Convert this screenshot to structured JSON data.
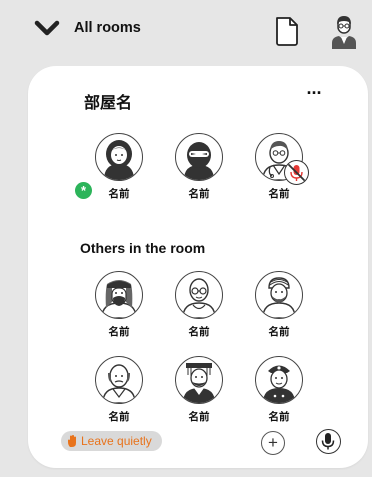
{
  "header": {
    "rooms_label": "All rooms",
    "icons": [
      "chevron-down-icon",
      "document-icon",
      "user-avatar-icon"
    ]
  },
  "room": {
    "name": "部屋名",
    "more_label": "···",
    "speakers": [
      {
        "name": "名前",
        "avatar": "hijab-woman-icon",
        "status": "active"
      },
      {
        "name": "名前",
        "avatar": "ninja-icon"
      },
      {
        "name": "名前",
        "avatar": "doctor-icon",
        "mic": "muted"
      }
    ],
    "others_title": "Others in the room",
    "others": [
      {
        "name": "名前",
        "avatar": "arab-man-icon"
      },
      {
        "name": "名前",
        "avatar": "bald-glasses-man-icon"
      },
      {
        "name": "名前",
        "avatar": "turban-man-icon"
      },
      {
        "name": "名前",
        "avatar": "old-man-icon"
      },
      {
        "name": "名前",
        "avatar": "chinese-emperor-icon"
      },
      {
        "name": "名前",
        "avatar": "police-officer-icon"
      }
    ],
    "status_symbol": "*"
  },
  "footer": {
    "leave_label": "Leave quietly",
    "add_label": "+",
    "colors": {
      "leave_text": "#e8731c",
      "leave_bg": "#d9d9d9",
      "active_status": "#2cb45a"
    }
  }
}
